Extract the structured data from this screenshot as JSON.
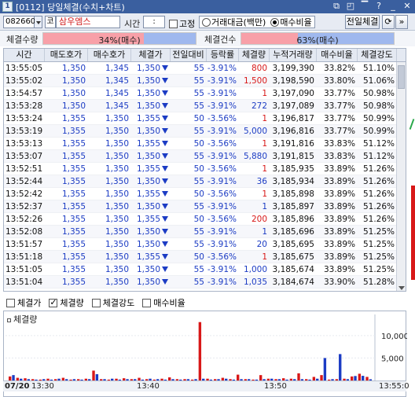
{
  "window": {
    "icon_label": "1",
    "title": "[0112] 당일체결(수치+차트)",
    "controls": [
      "⧉",
      "◰",
      "▔",
      "?",
      "_",
      "✕"
    ]
  },
  "toolbar": {
    "stock_code": "082660",
    "market_badge": "코",
    "stock_name": "삼우엠스",
    "time_label": "시간",
    "time_value": " : ",
    "fixed_label": "고정",
    "fixed_checked": false,
    "radio_amount_label": "거래대금(백만)",
    "radio_ratio_label": "매수비율",
    "selected_radio": "매수비율",
    "prev_day_button": "전일체결",
    "refresh_icon": "refresh-icon",
    "expand_icon": "expand-icon"
  },
  "strength": {
    "count_label": "체결수량",
    "count_text": "34%(매수)",
    "count_buy_percent": 34,
    "cases_label": "체결건수",
    "cases_text": "63%(매수)",
    "cases_buy_percent": 63
  },
  "table": {
    "headers": [
      "시간",
      "매도호가",
      "매수호가",
      "체결가",
      "전일대비",
      "등락률",
      "체결량",
      "누적거래량",
      "매수비율",
      "체결강도"
    ],
    "rows": [
      {
        "time": "13:55:05",
        "ask": "1,350",
        "bid": "1,345",
        "price": "1,350",
        "change": "55",
        "rate": "-3.91%",
        "volume": "800",
        "vol_side": "buy",
        "cum": "3,199,390",
        "ratio": "33.82%",
        "strength": "51.10%"
      },
      {
        "time": "13:55:02",
        "ask": "1,350",
        "bid": "1,345",
        "price": "1,350",
        "change": "55",
        "rate": "-3.91%",
        "volume": "1,500",
        "vol_side": "buy",
        "cum": "3,198,590",
        "ratio": "33.80%",
        "strength": "51.06%"
      },
      {
        "time": "13:54:57",
        "ask": "1,350",
        "bid": "1,345",
        "price": "1,350",
        "change": "55",
        "rate": "-3.91%",
        "volume": "1",
        "vol_side": "buy",
        "cum": "3,197,090",
        "ratio": "33.77%",
        "strength": "50.98%"
      },
      {
        "time": "13:53:28",
        "ask": "1,350",
        "bid": "1,345",
        "price": "1,350",
        "change": "55",
        "rate": "-3.91%",
        "volume": "272",
        "vol_side": "sell",
        "cum": "3,197,089",
        "ratio": "33.77%",
        "strength": "50.98%"
      },
      {
        "time": "13:53:24",
        "ask": "1,355",
        "bid": "1,350",
        "price": "1,355",
        "change": "50",
        "rate": "-3.56%",
        "volume": "1",
        "vol_side": "buy",
        "cum": "3,196,817",
        "ratio": "33.77%",
        "strength": "50.99%"
      },
      {
        "time": "13:53:19",
        "ask": "1,355",
        "bid": "1,350",
        "price": "1,350",
        "change": "55",
        "rate": "-3.91%",
        "volume": "5,000",
        "vol_side": "sell",
        "cum": "3,196,816",
        "ratio": "33.77%",
        "strength": "50.99%"
      },
      {
        "time": "13:53:13",
        "ask": "1,355",
        "bid": "1,350",
        "price": "1,355",
        "change": "50",
        "rate": "-3.56%",
        "volume": "1",
        "vol_side": "buy",
        "cum": "3,191,816",
        "ratio": "33.83%",
        "strength": "51.12%"
      },
      {
        "time": "13:53:07",
        "ask": "1,355",
        "bid": "1,350",
        "price": "1,350",
        "change": "55",
        "rate": "-3.91%",
        "volume": "5,880",
        "vol_side": "sell",
        "cum": "3,191,815",
        "ratio": "33.83%",
        "strength": "51.12%"
      },
      {
        "time": "13:52:51",
        "ask": "1,355",
        "bid": "1,350",
        "price": "1,355",
        "change": "50",
        "rate": "-3.56%",
        "volume": "1",
        "vol_side": "buy",
        "cum": "3,185,935",
        "ratio": "33.89%",
        "strength": "51.26%"
      },
      {
        "time": "13:52:44",
        "ask": "1,355",
        "bid": "1,350",
        "price": "1,350",
        "change": "55",
        "rate": "-3.91%",
        "volume": "36",
        "vol_side": "sell",
        "cum": "3,185,934",
        "ratio": "33.89%",
        "strength": "51.26%"
      },
      {
        "time": "13:52:42",
        "ask": "1,355",
        "bid": "1,350",
        "price": "1,355",
        "change": "50",
        "rate": "-3.56%",
        "volume": "1",
        "vol_side": "buy",
        "cum": "3,185,898",
        "ratio": "33.89%",
        "strength": "51.26%"
      },
      {
        "time": "13:52:37",
        "ask": "1,355",
        "bid": "1,350",
        "price": "1,350",
        "change": "55",
        "rate": "-3.91%",
        "volume": "1",
        "vol_side": "sell",
        "cum": "3,185,897",
        "ratio": "33.89%",
        "strength": "51.26%"
      },
      {
        "time": "13:52:26",
        "ask": "1,355",
        "bid": "1,350",
        "price": "1,355",
        "change": "50",
        "rate": "-3.56%",
        "volume": "200",
        "vol_side": "buy",
        "cum": "3,185,896",
        "ratio": "33.89%",
        "strength": "51.26%"
      },
      {
        "time": "13:52:08",
        "ask": "1,355",
        "bid": "1,350",
        "price": "1,350",
        "change": "55",
        "rate": "-3.91%",
        "volume": "1",
        "vol_side": "sell",
        "cum": "3,185,696",
        "ratio": "33.89%",
        "strength": "51.25%"
      },
      {
        "time": "13:51:57",
        "ask": "1,355",
        "bid": "1,350",
        "price": "1,350",
        "change": "55",
        "rate": "-3.91%",
        "volume": "20",
        "vol_side": "sell",
        "cum": "3,185,695",
        "ratio": "33.89%",
        "strength": "51.25%"
      },
      {
        "time": "13:51:18",
        "ask": "1,355",
        "bid": "1,350",
        "price": "1,355",
        "change": "50",
        "rate": "-3.56%",
        "volume": "1",
        "vol_side": "buy",
        "cum": "3,185,675",
        "ratio": "33.89%",
        "strength": "51.25%"
      },
      {
        "time": "13:51:05",
        "ask": "1,355",
        "bid": "1,350",
        "price": "1,350",
        "change": "55",
        "rate": "-3.91%",
        "volume": "1,000",
        "vol_side": "sell",
        "cum": "3,185,674",
        "ratio": "33.89%",
        "strength": "51.25%"
      },
      {
        "time": "13:51:04",
        "ask": "1,355",
        "bid": "1,350",
        "price": "1,350",
        "change": "55",
        "rate": "-3.91%",
        "volume": "1,035",
        "vol_side": "sell",
        "cum": "3,184,674",
        "ratio": "33.90%",
        "strength": "51.28%"
      }
    ]
  },
  "chart_options": [
    {
      "label": "체결가",
      "checked": false
    },
    {
      "label": "체결량",
      "checked": true
    },
    {
      "label": "체결강도",
      "checked": false
    },
    {
      "label": "매수비율",
      "checked": false
    }
  ],
  "colors": {
    "buy": "#d81818",
    "sell": "#1c3cc4",
    "title_bar": "#3a5f9f"
  },
  "chart_data": {
    "type": "bar",
    "title": "체결량",
    "y_ticks": [
      "10,000",
      "5,000"
    ],
    "ylim": [
      0,
      14000
    ],
    "date_label": "07/20",
    "x_ticks": [
      "13:30",
      "13:40",
      "13:50",
      "13:55:0"
    ],
    "series": [
      {
        "name": "buy",
        "color": "#d81818",
        "values": [
          900,
          600,
          500,
          300,
          200,
          400,
          300,
          600,
          200,
          300,
          400,
          2200,
          300,
          200,
          400,
          500,
          300,
          600,
          300,
          200,
          400,
          700,
          300,
          300,
          200,
          13000,
          400,
          300,
          600,
          300,
          1300,
          300,
          200,
          1200,
          400,
          300,
          500,
          400,
          1600,
          300,
          800,
          1200,
          200,
          300,
          400,
          900,
          1500,
          800
        ]
      },
      {
        "name": "sell",
        "color": "#1c3cc4",
        "values": [
          1200,
          400,
          300,
          200,
          300,
          200,
          400,
          300,
          300,
          200,
          300,
          1400,
          300,
          400,
          200,
          300,
          300,
          200,
          400,
          300,
          200,
          300,
          200,
          300,
          300,
          400,
          200,
          300,
          400,
          200,
          300,
          300,
          200,
          300,
          400,
          300,
          200,
          300,
          300,
          200,
          400,
          5000,
          300,
          5880,
          300,
          1000,
          1035,
          272
        ]
      }
    ]
  }
}
